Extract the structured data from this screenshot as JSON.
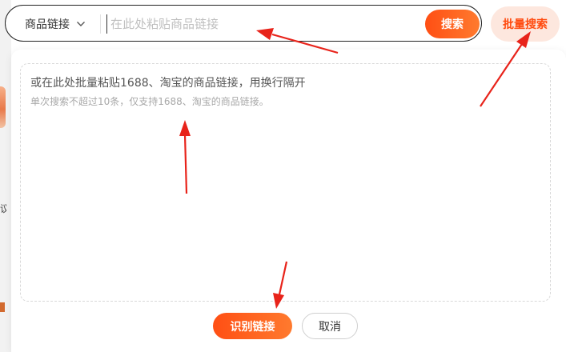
{
  "search": {
    "type_select_value": "商品链接",
    "placeholder": "在此处粘贴商品链接",
    "search_button_label": "搜索",
    "batch_search_button_label": "批量搜索"
  },
  "batch_panel": {
    "placeholder_main": "或在此处批量粘贴1688、淘宝的商品链接，用换行隔开",
    "placeholder_sub": "单次搜索不超过10条，仅支持1688、淘宝的商品链接。",
    "recognize_button_label": "识别链接",
    "cancel_button_label": "取消"
  },
  "background": {
    "partial_text": "议"
  },
  "colors": {
    "accent": "#ff5a1a",
    "accent_soft_bg": "#fde7de",
    "annotation_arrow": "#e8231a"
  }
}
